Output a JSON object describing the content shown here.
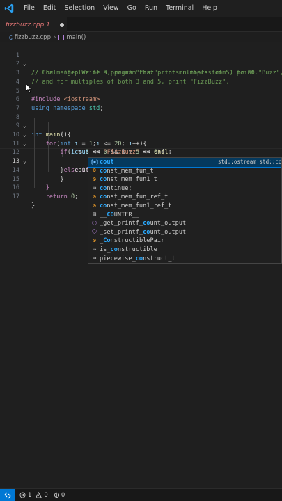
{
  "menubar": {
    "items": [
      "File",
      "Edit",
      "Selection",
      "View",
      "Go",
      "Run",
      "Terminal",
      "Help"
    ]
  },
  "tab": {
    "label": "fizzbuzz.cpp 1"
  },
  "breadcrumbs": {
    "file": "fizzbuzz.cpp",
    "symbol": "main()"
  },
  "editor": {
    "line_numbers": [
      "1",
      "2",
      "3",
      "4",
      "5",
      "6",
      "7",
      "8",
      "9",
      "10",
      "11",
      "12",
      "13",
      "14",
      "15",
      "16",
      "17"
    ],
    "line1": "// Challenge: Write a program that prints numbers from 1 to 20.",
    "line2": "// For multiples of 3, print \"Fizz\", for multiples of 5, print \"Buzz\",",
    "line3": "// and for multiples of both 3 and 5, print \"FizzBuzz\".",
    "line5_directive": "#include",
    "line5_header": "<iostream>",
    "line6_using": "using",
    "line6_namespace": "namespace",
    "line6_std": "std",
    "line8_int": "int",
    "line8_main": "main",
    "line9_for": "for",
    "line9_int": "int",
    "line9_i": "i",
    "line10_if": "if",
    "line11_cout": "cout",
    "line11_str": "\"FizzBuzz\"",
    "line11_endl": "endl",
    "line12_else": "else",
    "line12_if": "if",
    "line13_typed": "cout",
    "line16_return": "return",
    "num_0": "0",
    "num_1": "1",
    "num_20": "20",
    "num_3": "3",
    "num_5": "5"
  },
  "suggestions": {
    "items": [
      {
        "match": "cout",
        "rest": "",
        "kind": "variable",
        "detail": "std::ostream std::cout"
      },
      {
        "match": "",
        "rest": "const_mem_fun_t",
        "kind": "class"
      },
      {
        "match": "",
        "rest": "const_mem_fun1_t",
        "kind": "class"
      },
      {
        "match": "",
        "rest": "continue;",
        "kind": "snippet"
      },
      {
        "match": "",
        "rest": "const_mem_fun_ref_t",
        "kind": "class"
      },
      {
        "match": "",
        "rest": "const_mem_fun1_ref_t",
        "kind": "class"
      },
      {
        "match": "",
        "rest": "__COUNTER__",
        "kind": "constant"
      },
      {
        "match": "",
        "rest": "_get_printf_count_output",
        "kind": "function"
      },
      {
        "match": "",
        "rest": "_set_printf_count_output",
        "kind": "function"
      },
      {
        "match": "",
        "rest": "_ConstructiblePair",
        "kind": "class"
      },
      {
        "match": "",
        "rest": "is_constructible",
        "kind": "snippet"
      },
      {
        "match": "",
        "rest": "piecewise_construct_t",
        "kind": "snippet"
      }
    ]
  },
  "statusbar": {
    "errors": "1",
    "warnings": "0",
    "ports": "0"
  },
  "colors": {
    "accent": "#0078d4",
    "tab_label": "#e07474",
    "comment": "#6a9955",
    "keyword": "#569cd6",
    "control": "#c586c0",
    "string": "#ce9178",
    "number": "#b5cea8",
    "variable": "#9cdcfe",
    "function": "#dcdcaa",
    "match_highlight": "#2aaaff"
  }
}
